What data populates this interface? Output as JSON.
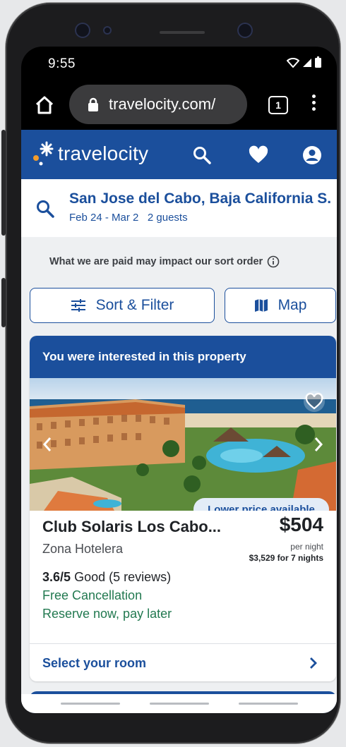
{
  "status_bar": {
    "time": "9:55"
  },
  "browser": {
    "url": "travelocity.com/",
    "tab_count": "1"
  },
  "header": {
    "logo_text": "travelocity"
  },
  "search": {
    "destination": "San Jose del Cabo, Baja California S...",
    "dates": "Feb 24 - Mar 2",
    "guests": "2 guests"
  },
  "disclaimer": "What we are paid may impact our sort order",
  "actions": {
    "sort_filter_label": "Sort & Filter",
    "map_label": "Map"
  },
  "property": {
    "banner": "You were interested in this property",
    "badge": "Lower price available",
    "name": "Club Solaris Los Cabo...",
    "area": "Zona Hotelera",
    "price": "$504",
    "per_night": "per night",
    "total": "$3,529 for 7 nights",
    "rating_score": "3.6/5",
    "rating_text": "Good (5 reviews)",
    "free_cancellation": "Free Cancellation",
    "reserve_text": "Reserve now, pay later",
    "select_room": "Select your room"
  },
  "colors": {
    "brand": "#1b4f9c",
    "green": "#227950",
    "badge_bg": "#e3ecf7",
    "logo_accent": "#f39c2b"
  }
}
